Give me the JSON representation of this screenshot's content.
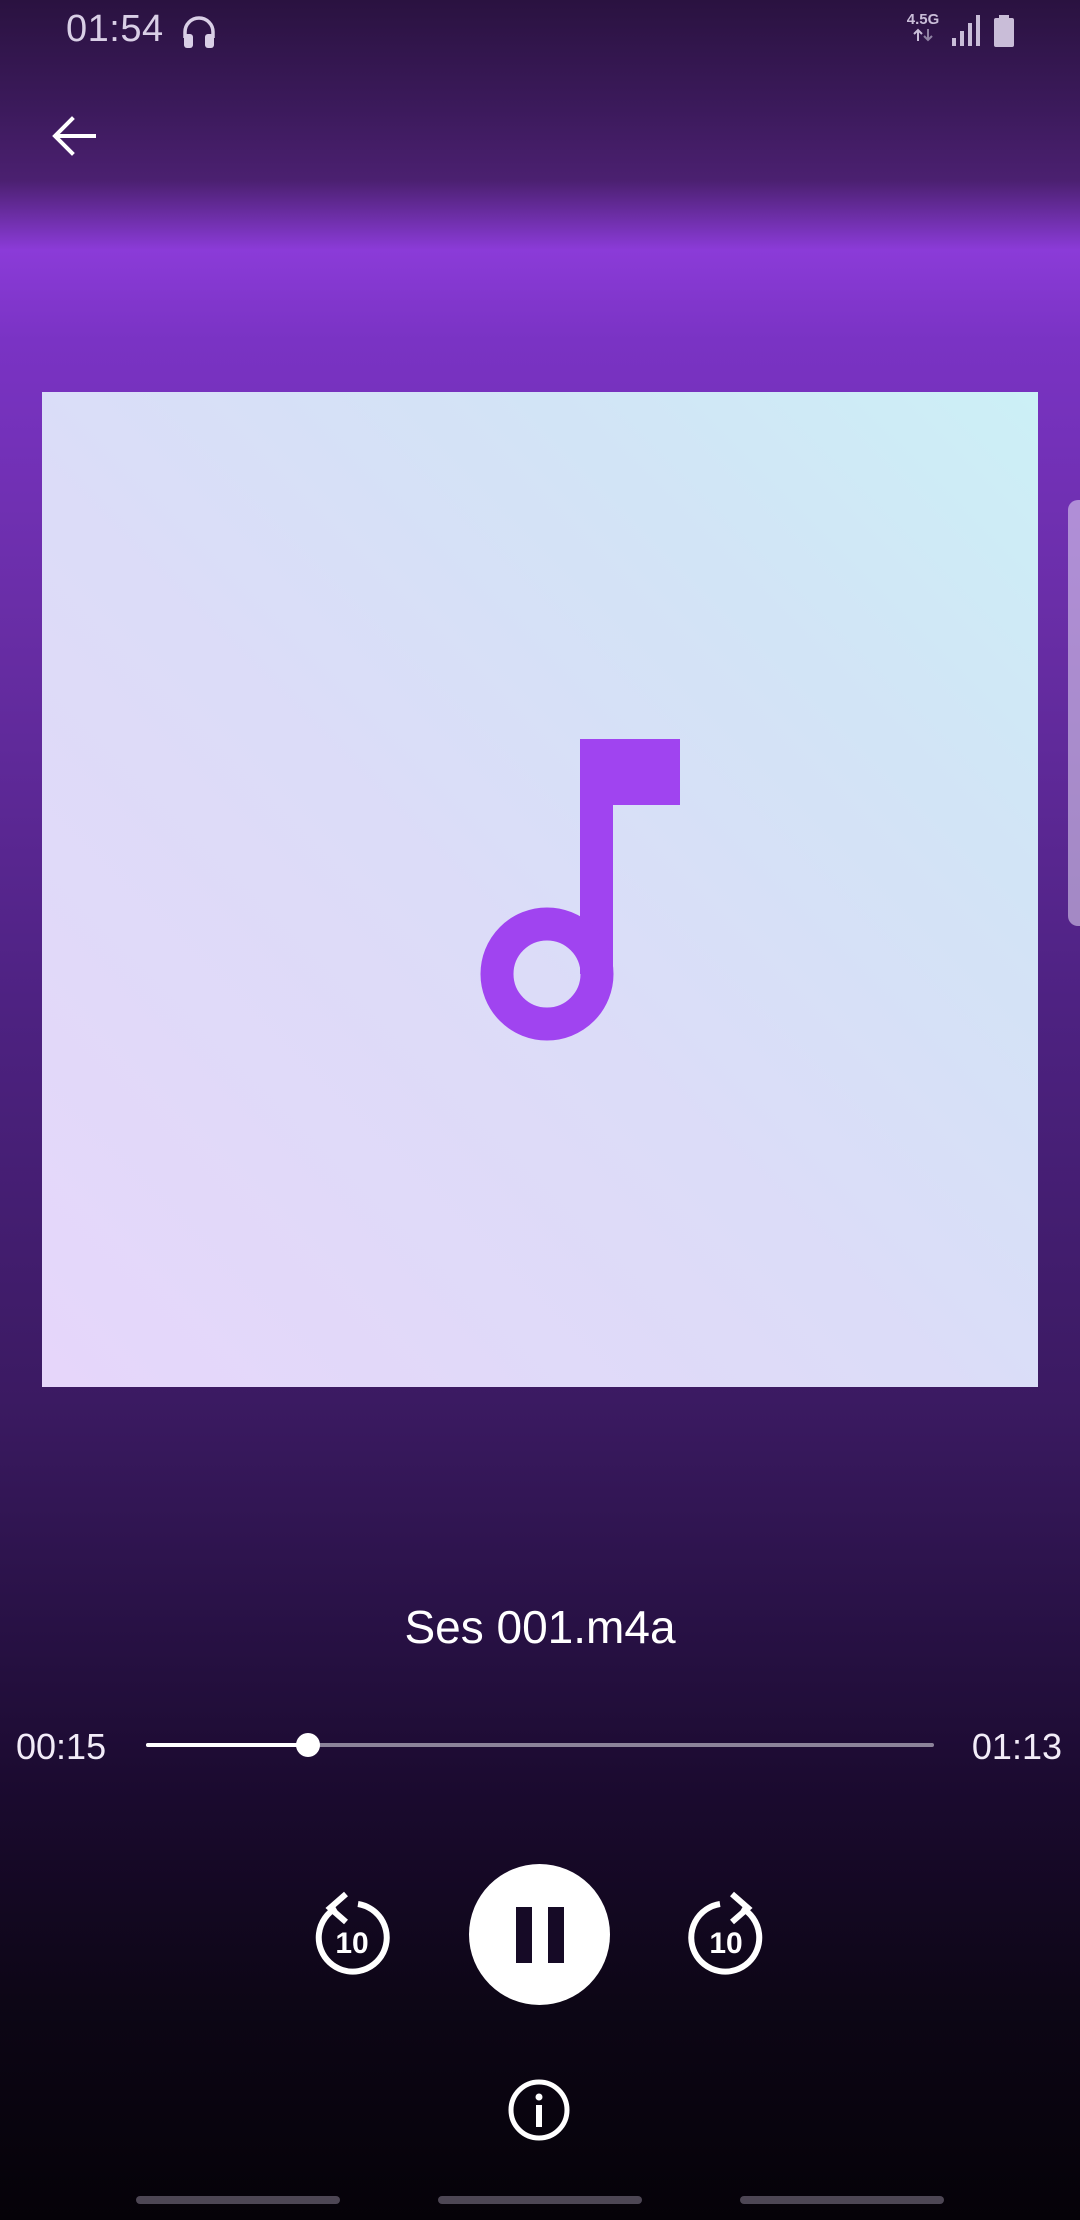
{
  "status_bar": {
    "time": "01:54",
    "network_type": "4.5G"
  },
  "track": {
    "title": "Ses 001.m4a",
    "elapsed": "00:15",
    "duration": "01:13",
    "progress_fraction": 0.205
  },
  "controls": {
    "rewind_seconds": "10",
    "forward_seconds": "10"
  },
  "colors": {
    "accent": "#a044f0",
    "header_purple": "#8b3bd8"
  },
  "icons": {
    "back": "arrow-left-icon",
    "album_placeholder": "music-note-icon",
    "rewind": "replay-10-icon",
    "pause": "pause-icon",
    "forward": "forward-10-icon",
    "info": "info-icon"
  }
}
